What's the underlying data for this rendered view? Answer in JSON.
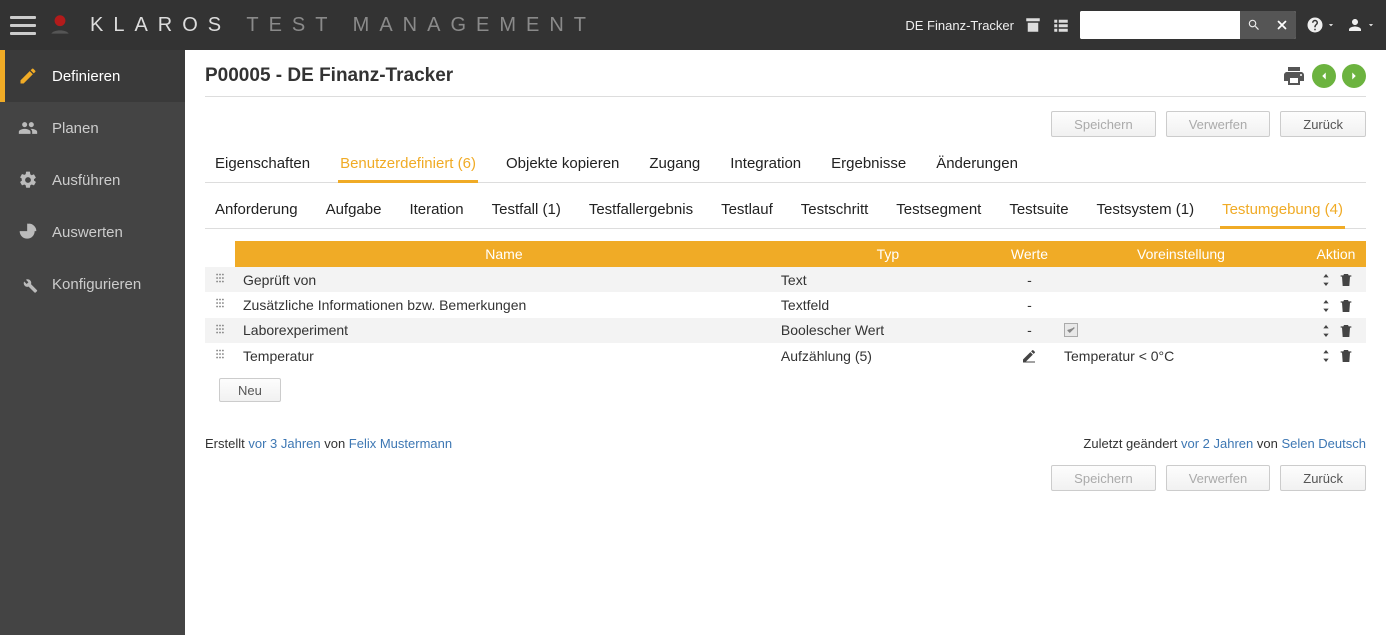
{
  "brand": {
    "main": "KLAROS",
    "sub": "TEST MANAGEMENT"
  },
  "topbar": {
    "project": "DE Finanz-Tracker",
    "search_placeholder": ""
  },
  "sidebar": {
    "items": [
      {
        "label": "Definieren"
      },
      {
        "label": "Planen"
      },
      {
        "label": "Ausführen"
      },
      {
        "label": "Auswerten"
      },
      {
        "label": "Konfigurieren"
      }
    ]
  },
  "page": {
    "title": "P00005 - DE Finanz-Tracker"
  },
  "actions": {
    "save": "Speichern",
    "discard": "Verwerfen",
    "back": "Zurück",
    "new": "Neu"
  },
  "tabs": [
    {
      "label": "Eigenschaften"
    },
    {
      "label": "Benutzerdefiniert (6)"
    },
    {
      "label": "Objekte kopieren"
    },
    {
      "label": "Zugang"
    },
    {
      "label": "Integration"
    },
    {
      "label": "Ergebnisse"
    },
    {
      "label": "Änderungen"
    }
  ],
  "subtabs": [
    {
      "label": "Anforderung"
    },
    {
      "label": "Aufgabe"
    },
    {
      "label": "Iteration"
    },
    {
      "label": "Testfall (1)"
    },
    {
      "label": "Testfallergebnis"
    },
    {
      "label": "Testlauf"
    },
    {
      "label": "Testschritt"
    },
    {
      "label": "Testsegment"
    },
    {
      "label": "Testsuite"
    },
    {
      "label": "Testsystem (1)"
    },
    {
      "label": "Testumgebung (4)"
    }
  ],
  "table": {
    "headers": {
      "name": "Name",
      "type": "Typ",
      "values": "Werte",
      "default": "Voreinstellung",
      "action": "Aktion"
    },
    "rows": [
      {
        "name": "Geprüft von",
        "type": "Text",
        "values": "-",
        "default": "",
        "edit": false,
        "check": false
      },
      {
        "name": "Zusätzliche Informationen bzw. Bemerkungen",
        "type": "Textfeld",
        "values": "-",
        "default": "",
        "edit": false,
        "check": false
      },
      {
        "name": "Laborexperiment",
        "type": "Boolescher Wert",
        "values": "-",
        "default": "",
        "edit": false,
        "check": true
      },
      {
        "name": "Temperatur",
        "type": "Aufzählung (5)",
        "values": "",
        "default": "Temperatur < 0°C",
        "edit": true,
        "check": false
      }
    ]
  },
  "meta": {
    "created_label": "Erstellt ",
    "created_time": "vor 3 Jahren",
    "by": " von ",
    "created_user": "Felix Mustermann",
    "modified_label": "Zuletzt geändert ",
    "modified_time": "vor 2 Jahren",
    "modified_user": "Selen Deutsch"
  }
}
